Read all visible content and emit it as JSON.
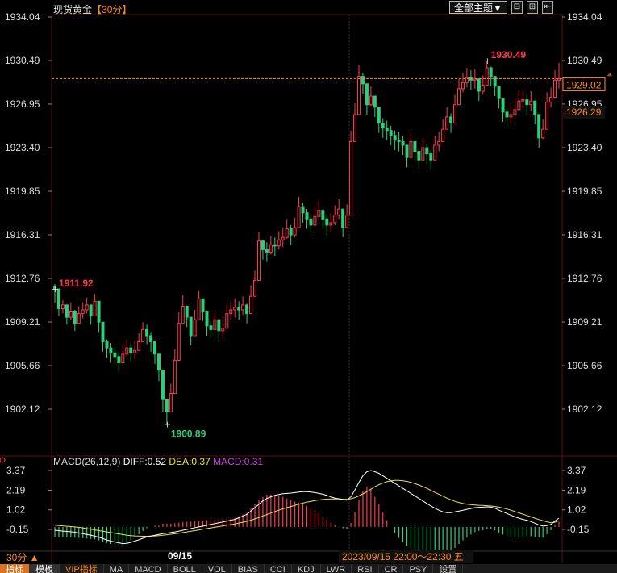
{
  "header": {
    "title": "现货黄金",
    "period": "【30分】",
    "theme_button": "全部主题▼",
    "win_buttons": [
      "⊟",
      "⊞",
      "⇤"
    ]
  },
  "price_axis": {
    "ticks": [
      "1934.04",
      "1930.49",
      "1926.95",
      "1923.40",
      "1919.85",
      "1916.31",
      "1912.76",
      "1909.21",
      "1905.66",
      "1902.12"
    ],
    "current_price_label": "1929.02",
    "secondary_price_label": "1926.29"
  },
  "annotations": {
    "high_label": "1930.49",
    "low_label": "1900.89",
    "start_label": "1911.92"
  },
  "macd": {
    "legend": "MACD(26,12,9)",
    "diff": "DIFF:0.52",
    "dea": "DEA:0.37",
    "macd": "MACD:0.31",
    "ticks": [
      "3.37",
      "2.19",
      "1.02",
      "-0.15"
    ]
  },
  "footer": {
    "period_label": "30分 ▲",
    "date_label": "09/15",
    "time_range": "2023/09/15 22:00～22:30 五"
  },
  "tabs": [
    "指标",
    "模板",
    "VIP指标",
    "MA",
    "MACD",
    "BOLL",
    "VOL",
    "BIAS",
    "CCI",
    "KDJ",
    "LWR",
    "RSI",
    "CR",
    "PSY",
    "设置"
  ],
  "colors": {
    "up": "#ff3b4e",
    "down": "#2fcf7a",
    "diff_line": "#ffffff",
    "dea_line": "#f0e040",
    "macd_label": "#d040e0",
    "accent": "#ff8a1e"
  },
  "chart_data": {
    "type": "candlestick",
    "ylim": [
      1900.0,
      1934.8
    ],
    "close": [
      1911.9,
      1910.3,
      1910.6,
      1909.6,
      1910.1,
      1909.1,
      1909.9,
      1910.2,
      1910.6,
      1909.7,
      1910.9,
      1909.2,
      1907.6,
      1907.1,
      1906.7,
      1906.4,
      1905.9,
      1906.6,
      1907.1,
      1906.7,
      1906.9,
      1907.6,
      1908.6,
      1908.1,
      1907.6,
      1906.6,
      1905.3,
      1902.9,
      1901.9,
      1903.4,
      1906.1,
      1909.1,
      1910.5,
      1909.6,
      1908.1,
      1909.4,
      1911.1,
      1910.1,
      1908.9,
      1908.6,
      1909.4,
      1908.5,
      1908.7,
      1909.9,
      1910.2,
      1910.4,
      1910.2,
      1910.6,
      1909.9,
      1911.3,
      1912.6,
      1915.8,
      1915.1,
      1914.9,
      1915.5,
      1915.4,
      1915.9,
      1916.1,
      1916.8,
      1916.3,
      1916.9,
      1918.6,
      1918.1,
      1917.6,
      1917.1,
      1917.8,
      1918.3,
      1917.6,
      1917.1,
      1917.3,
      1917.9,
      1918.4,
      1916.9,
      1917.9,
      1923.9,
      1926.1,
      1929.2,
      1928.6,
      1926.9,
      1927.6,
      1926.7,
      1925.4,
      1925.0,
      1924.8,
      1924.4,
      1924.0,
      1923.9,
      1923.6,
      1922.6,
      1923.9,
      1923.1,
      1922.4,
      1923.4,
      1922.9,
      1922.4,
      1923.6,
      1923.9,
      1924.9,
      1925.9,
      1925.4,
      1926.9,
      1928.2,
      1928.7,
      1929.1,
      1928.9,
      1929.0,
      1928.0,
      1928.5,
      1929.9,
      1929.2,
      1928.4,
      1927.4,
      1926.3,
      1925.9,
      1926.1,
      1926.5,
      1927.2,
      1927.3,
      1926.9,
      1927.2,
      1926.1,
      1924.2,
      1924.9,
      1927.1,
      1927.5,
      1928.9,
      1929.0
    ],
    "high": [
      1912.3,
      1911.2,
      1911.0,
      1910.5,
      1910.8,
      1910.2,
      1910.5,
      1910.8,
      1911.2,
      1910.6,
      1911.5,
      1910.0,
      1908.4,
      1907.8,
      1907.5,
      1907.2,
      1906.8,
      1907.4,
      1907.8,
      1907.5,
      1907.7,
      1908.3,
      1909.2,
      1909.0,
      1908.4,
      1907.4,
      1906.2,
      1904.0,
      1902.8,
      1904.2,
      1907.0,
      1910.0,
      1911.4,
      1910.5,
      1909.0,
      1910.2,
      1911.8,
      1911.0,
      1909.8,
      1909.4,
      1910.1,
      1909.4,
      1909.6,
      1910.6,
      1910.9,
      1911.1,
      1910.9,
      1911.3,
      1910.7,
      1912.2,
      1913.4,
      1916.5,
      1915.9,
      1915.7,
      1916.2,
      1916.1,
      1916.6,
      1916.9,
      1917.6,
      1917.1,
      1917.7,
      1919.4,
      1918.9,
      1918.4,
      1917.9,
      1918.6,
      1919.1,
      1918.4,
      1917.9,
      1918.1,
      1918.7,
      1919.2,
      1917.8,
      1918.8,
      1924.8,
      1927.0,
      1930.1,
      1929.5,
      1927.8,
      1928.4,
      1927.5,
      1926.2,
      1925.8,
      1925.6,
      1925.2,
      1924.8,
      1924.7,
      1924.4,
      1923.4,
      1924.7,
      1923.9,
      1923.2,
      1924.2,
      1923.7,
      1923.2,
      1924.4,
      1924.7,
      1925.7,
      1926.7,
      1926.2,
      1927.7,
      1929.0,
      1929.5,
      1929.9,
      1929.7,
      1929.8,
      1928.8,
      1929.3,
      1930.5,
      1930.0,
      1929.2,
      1928.2,
      1927.1,
      1926.7,
      1926.9,
      1927.3,
      1928.0,
      1928.1,
      1927.7,
      1928.0,
      1926.9,
      1925.0,
      1925.7,
      1927.9,
      1928.3,
      1929.7,
      1930.3
    ],
    "low": [
      1910.8,
      1909.7,
      1909.9,
      1909.0,
      1909.4,
      1908.5,
      1909.2,
      1909.5,
      1909.9,
      1909.0,
      1910.1,
      1908.4,
      1906.8,
      1906.3,
      1905.9,
      1905.6,
      1905.2,
      1905.9,
      1906.4,
      1906.0,
      1906.2,
      1906.9,
      1907.9,
      1907.4,
      1906.8,
      1905.8,
      1904.4,
      1901.9,
      1900.9,
      1902.6,
      1905.3,
      1908.3,
      1909.7,
      1908.8,
      1907.3,
      1908.6,
      1910.3,
      1909.3,
      1908.1,
      1907.8,
      1908.6,
      1907.7,
      1907.9,
      1909.1,
      1909.4,
      1909.6,
      1909.4,
      1909.8,
      1909.1,
      1910.5,
      1911.8,
      1915.0,
      1914.3,
      1914.1,
      1914.7,
      1914.6,
      1915.1,
      1915.3,
      1916.0,
      1915.5,
      1916.1,
      1917.8,
      1917.3,
      1916.8,
      1916.3,
      1917.0,
      1917.5,
      1916.8,
      1916.3,
      1916.5,
      1917.1,
      1917.6,
      1916.1,
      1917.1,
      1923.1,
      1925.3,
      1928.4,
      1927.8,
      1926.1,
      1926.8,
      1925.9,
      1924.6,
      1924.2,
      1924.0,
      1923.6,
      1923.2,
      1923.1,
      1922.8,
      1921.8,
      1923.1,
      1922.3,
      1921.6,
      1922.6,
      1922.1,
      1921.6,
      1922.8,
      1923.1,
      1924.1,
      1925.1,
      1924.6,
      1926.1,
      1927.4,
      1927.9,
      1928.3,
      1928.1,
      1928.2,
      1927.2,
      1927.7,
      1929.1,
      1928.4,
      1927.6,
      1926.6,
      1925.5,
      1925.1,
      1925.3,
      1925.7,
      1926.4,
      1926.5,
      1926.1,
      1926.4,
      1925.3,
      1923.4,
      1924.1,
      1926.3,
      1926.7,
      1928.1,
      1928.2
    ],
    "macd_ylim": [
      -1.1,
      3.9
    ],
    "diff": [
      -0.2,
      -0.22,
      -0.25,
      -0.27,
      -0.29,
      -0.32,
      -0.36,
      -0.4,
      -0.45,
      -0.5,
      -0.55,
      -0.62,
      -0.7,
      -0.78,
      -0.85,
      -0.9,
      -0.95,
      -1.0,
      -0.98,
      -0.92,
      -0.85,
      -0.77,
      -0.68,
      -0.6,
      -0.55,
      -0.5,
      -0.45,
      -0.4,
      -0.37,
      -0.34,
      -0.3,
      -0.25,
      -0.2,
      -0.15,
      -0.1,
      -0.05,
      0.0,
      0.05,
      0.1,
      0.15,
      0.2,
      0.25,
      0.3,
      0.35,
      0.4,
      0.45,
      0.55,
      0.65,
      0.75,
      0.95,
      1.15,
      1.35,
      1.55,
      1.7,
      1.8,
      1.88,
      1.94,
      1.98,
      2.0,
      2.02,
      2.05,
      2.08,
      2.1,
      2.1,
      2.08,
      2.05,
      2.0,
      1.95,
      1.88,
      1.8,
      1.72,
      1.68,
      1.62,
      1.6,
      1.8,
      2.2,
      2.65,
      3.05,
      3.3,
      3.37,
      3.3,
      3.2,
      3.05,
      2.9,
      2.75,
      2.6,
      2.45,
      2.3,
      2.15,
      2.0,
      1.85,
      1.7,
      1.55,
      1.4,
      1.25,
      1.12,
      1.0,
      0.9,
      0.85,
      0.85,
      0.9,
      0.95,
      1.0,
      1.05,
      1.1,
      1.15,
      1.17,
      1.18,
      1.2,
      1.18,
      1.12,
      1.0,
      0.9,
      0.8,
      0.7,
      0.6,
      0.52,
      0.45,
      0.4,
      0.32,
      0.22,
      0.12,
      0.05,
      0.08,
      0.15,
      0.35,
      0.52
    ],
    "dea": [
      0.1,
      0.08,
      0.06,
      0.04,
      0.02,
      0.0,
      -0.03,
      -0.06,
      -0.1,
      -0.14,
      -0.18,
      -0.22,
      -0.26,
      -0.3,
      -0.34,
      -0.38,
      -0.42,
      -0.46,
      -0.5,
      -0.52,
      -0.54,
      -0.55,
      -0.56,
      -0.56,
      -0.55,
      -0.54,
      -0.52,
      -0.5,
      -0.47,
      -0.44,
      -0.41,
      -0.38,
      -0.34,
      -0.3,
      -0.26,
      -0.22,
      -0.18,
      -0.14,
      -0.1,
      -0.06,
      -0.02,
      0.02,
      0.06,
      0.1,
      0.14,
      0.18,
      0.23,
      0.28,
      0.33,
      0.4,
      0.48,
      0.56,
      0.65,
      0.74,
      0.83,
      0.92,
      1.0,
      1.08,
      1.15,
      1.22,
      1.29,
      1.36,
      1.42,
      1.48,
      1.53,
      1.57,
      1.61,
      1.64,
      1.66,
      1.67,
      1.67,
      1.67,
      1.66,
      1.65,
      1.68,
      1.75,
      1.85,
      1.97,
      2.1,
      2.25,
      2.4,
      2.52,
      2.62,
      2.7,
      2.75,
      2.78,
      2.78,
      2.76,
      2.72,
      2.66,
      2.58,
      2.5,
      2.4,
      2.3,
      2.18,
      2.06,
      1.95,
      1.83,
      1.72,
      1.62,
      1.53,
      1.46,
      1.4,
      1.36,
      1.33,
      1.31,
      1.29,
      1.28,
      1.27,
      1.25,
      1.22,
      1.18,
      1.13,
      1.07,
      1.0,
      0.92,
      0.84,
      0.76,
      0.68,
      0.6,
      0.52,
      0.44,
      0.37,
      0.3,
      0.25,
      0.28,
      0.37
    ]
  }
}
